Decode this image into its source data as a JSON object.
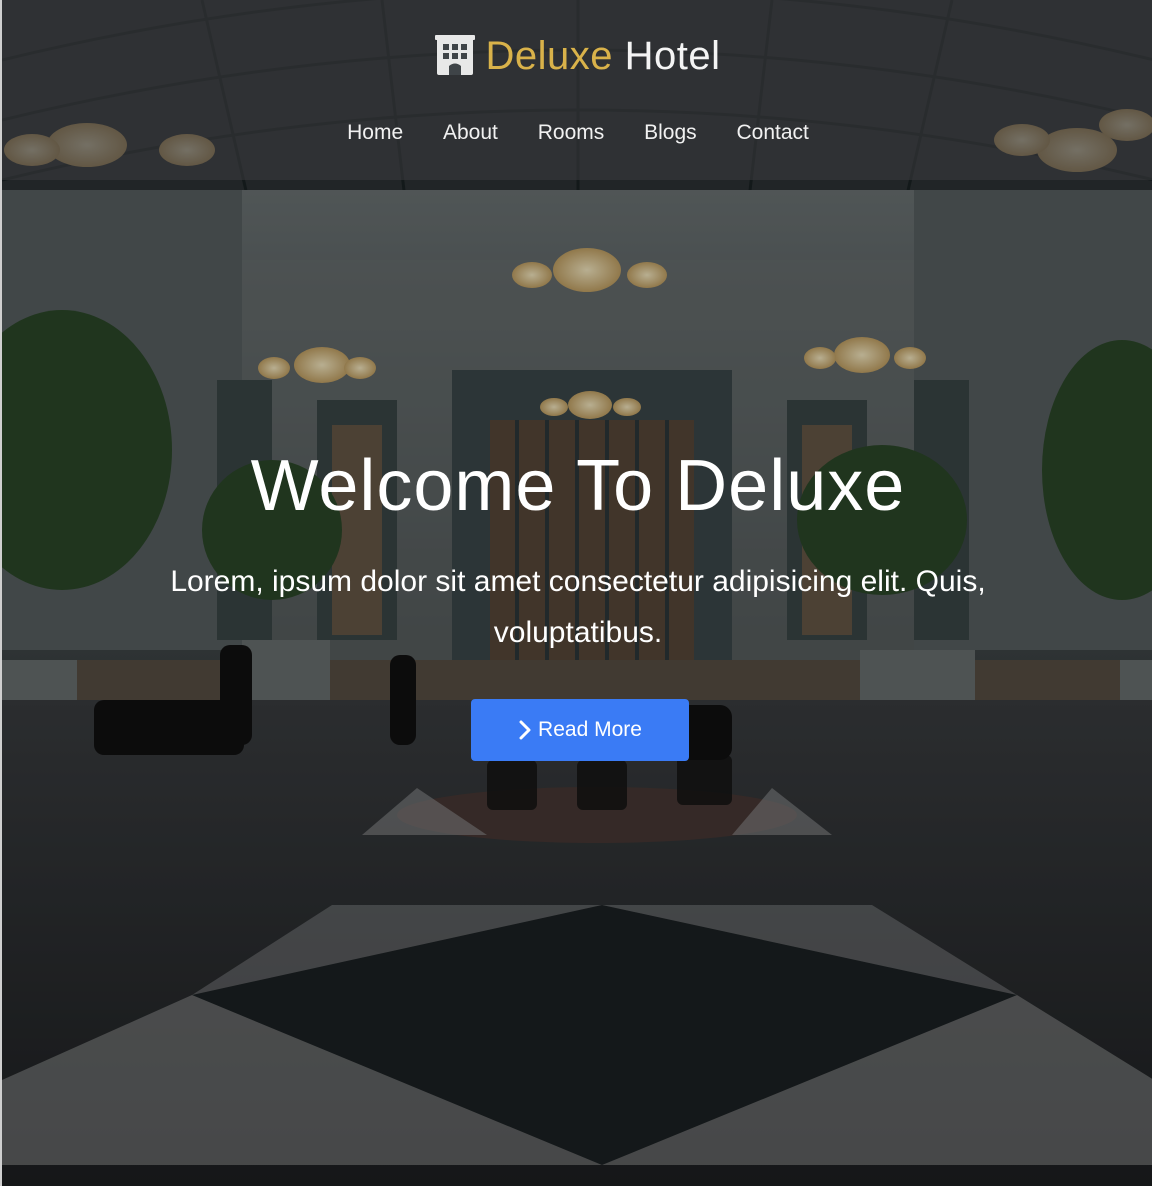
{
  "brand": {
    "accent_word": "Deluxe",
    "rest_word": " Hotel",
    "icon": "hotel-building-icon",
    "accent_color": "#d9b24a"
  },
  "nav": {
    "items": [
      {
        "label": "Home"
      },
      {
        "label": "About"
      },
      {
        "label": "Rooms"
      },
      {
        "label": "Blogs"
      },
      {
        "label": "Contact"
      }
    ]
  },
  "hero": {
    "title": "Welcome To Deluxe",
    "subtitle": "Lorem, ipsum dolor sit amet consectetur adipisicing elit. Quis, voluptatibus.",
    "cta_label": "Read More",
    "cta_icon": "chevron-right-icon",
    "cta_color": "#3a7bf5",
    "background": "hotel-atrium-photo"
  }
}
